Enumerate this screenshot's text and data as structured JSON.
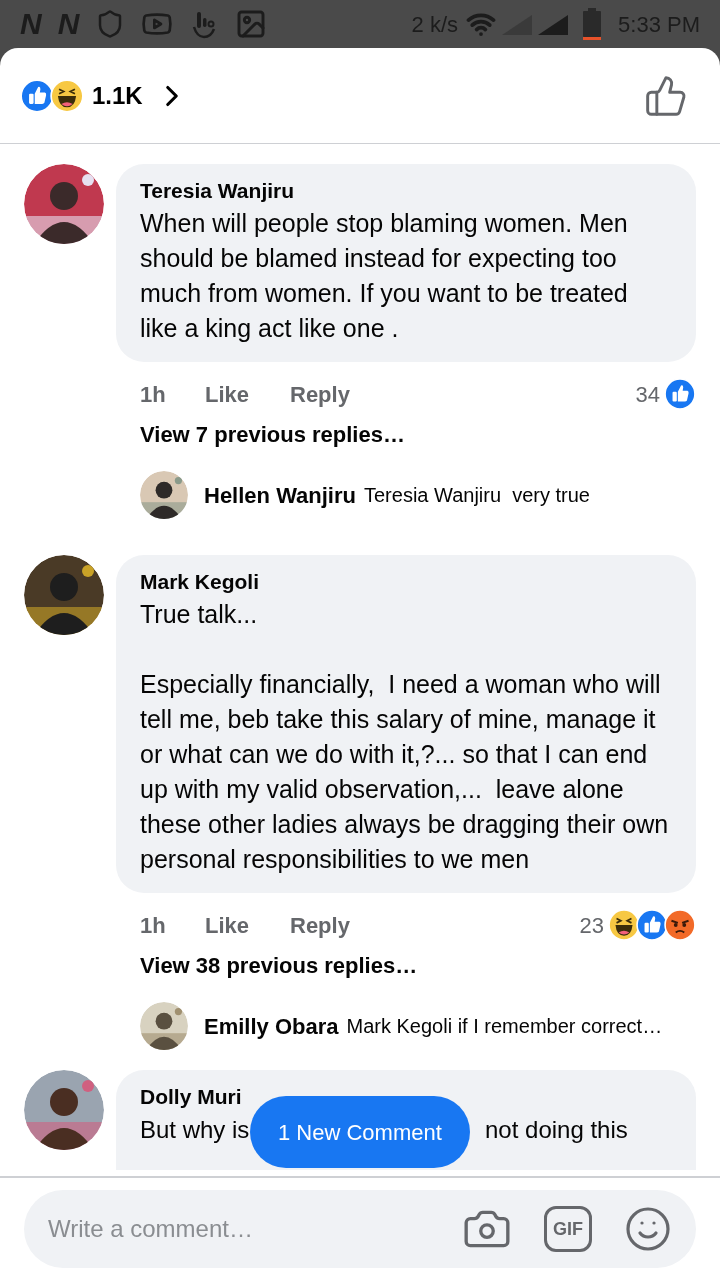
{
  "status_bar": {
    "notification_glyphs": [
      "N",
      "N"
    ],
    "speed": "2 k/s",
    "time": "5:33 PM"
  },
  "header": {
    "reactions": [
      {
        "kind": "like"
      },
      {
        "kind": "haha"
      }
    ],
    "count": "1.1K"
  },
  "comments": [
    {
      "author": "Teresia Wanjiru",
      "paragraphs": [
        "When will people stop blaming women. Men should be blamed instead for expecting too much from women. If you want to be treated like a king act like one ."
      ],
      "time": "1h",
      "like": "Like",
      "reply": "Reply",
      "reaction_count": "34",
      "reactions": [
        {
          "kind": "like"
        }
      ],
      "view_replies": "View 7 previous replies…",
      "latest_reply": {
        "author": "Hellen Wanjiru",
        "text": "Teresia Wanjiru  very true"
      }
    },
    {
      "author": "Mark Kegoli",
      "paragraphs": [
        "True talk...",
        "Especially financially,  I need a woman who will tell me, beb take this salary of mine, manage it or what can we do with it,?... so that I can end up with my valid observation,...  leave alone these other ladies always be dragging their own personal responsibilities to we men"
      ],
      "time": "1h",
      "like": "Like",
      "reply": "Reply",
      "reaction_count": "23",
      "reactions": [
        {
          "kind": "haha"
        },
        {
          "kind": "like"
        },
        {
          "kind": "angry"
        }
      ],
      "view_replies": "View 38 previous replies…",
      "latest_reply": {
        "author": "Emilly Obara",
        "text": "Mark Kegoli if I remember correct…"
      }
    }
  ],
  "partial_comment": {
    "author": "Dolly Muri",
    "text_parts": [
      "But why is",
      "not doing this"
    ]
  },
  "new_comment_toast": "1 New Comment",
  "composer": {
    "placeholder": "Write a comment…",
    "gif": "GIF"
  }
}
